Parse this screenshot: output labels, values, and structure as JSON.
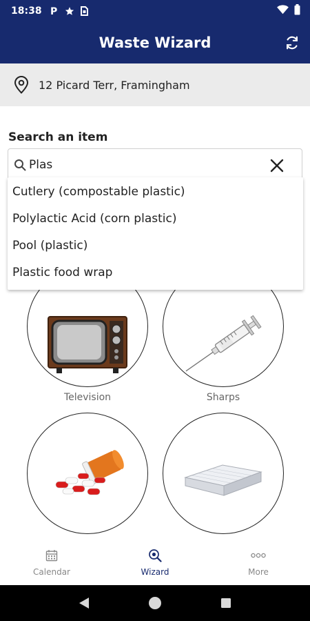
{
  "status_bar": {
    "time": "18:38",
    "icons": [
      "parking-icon",
      "star-icon",
      "sim-card-icon",
      "wifi-icon",
      "battery-icon"
    ]
  },
  "app_bar": {
    "title": "Waste Wizard",
    "refresh_icon": "refresh-icon"
  },
  "address_bar": {
    "icon": "location-pin-icon",
    "address": "12 Picard Terr, Framingham"
  },
  "search": {
    "label": "Search an item",
    "value": "Plas",
    "icon": "search-icon",
    "clear_icon": "close-icon",
    "suggestions": [
      "Cutlery (compostable plastic)",
      "Polylactic Acid (corn plastic)",
      "Pool (plastic)",
      "Plastic food wrap"
    ]
  },
  "tiles": [
    {
      "label": "Television",
      "image": "television-image"
    },
    {
      "label": "Sharps",
      "image": "syringe-image"
    },
    {
      "label": "",
      "image": "medication-pills-image"
    },
    {
      "label": "",
      "image": "mattress-image"
    }
  ],
  "bottom_nav": {
    "items": [
      {
        "label": "Calendar",
        "icon": "calendar-icon",
        "active": false
      },
      {
        "label": "Wizard",
        "icon": "wizard-search-icon",
        "active": true
      },
      {
        "label": "More",
        "icon": "more-dots-icon",
        "active": false
      }
    ]
  },
  "system_nav": [
    "back-icon",
    "home-icon",
    "recents-icon"
  ],
  "colors": {
    "primary": "#172a6e",
    "address_background": "#ebebeb",
    "inactive_nav": "#888888"
  }
}
